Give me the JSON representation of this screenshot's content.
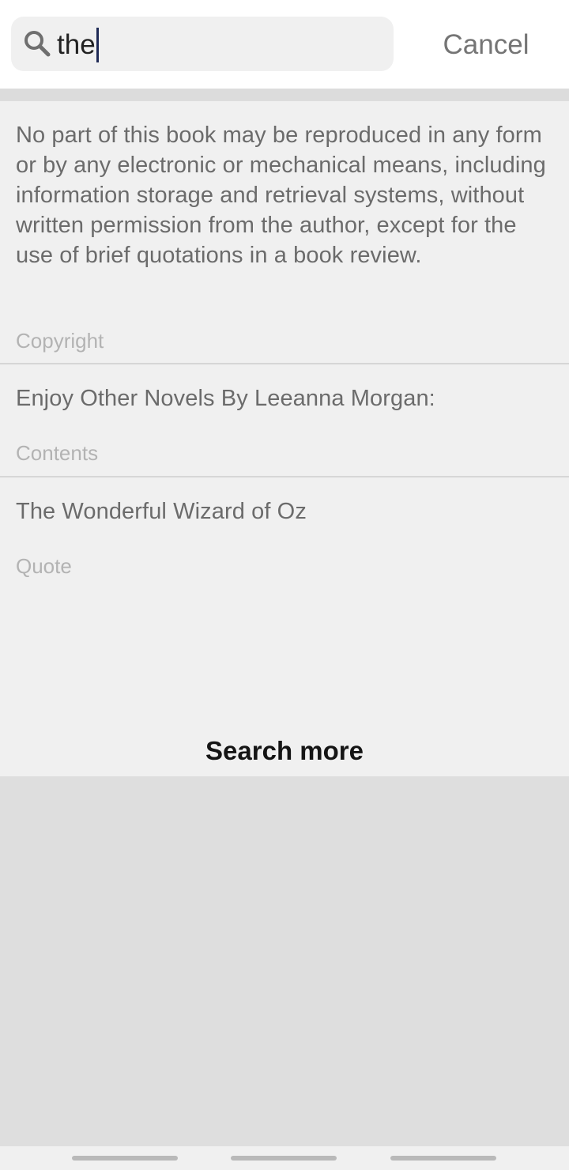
{
  "search": {
    "query": "the",
    "cancel_label": "Cancel"
  },
  "results": [
    {
      "text": "No part of this book may be reproduced in any form or by any electronic or mechanical means, including information storage and retrieval systems, without written permission from the author, except for the use of brief quotations in a book review.",
      "section": "Copyright"
    },
    {
      "text": "Enjoy Other Novels By Leeanna Morgan:",
      "section": "Contents"
    },
    {
      "text": "The Wonderful Wizard of Oz",
      "section": "Quote"
    }
  ],
  "search_more_label": "Search more",
  "colors": {
    "accent_caret": "#1f2a56",
    "panel_background": "#f0f0f0",
    "page_background": "#dedede"
  }
}
